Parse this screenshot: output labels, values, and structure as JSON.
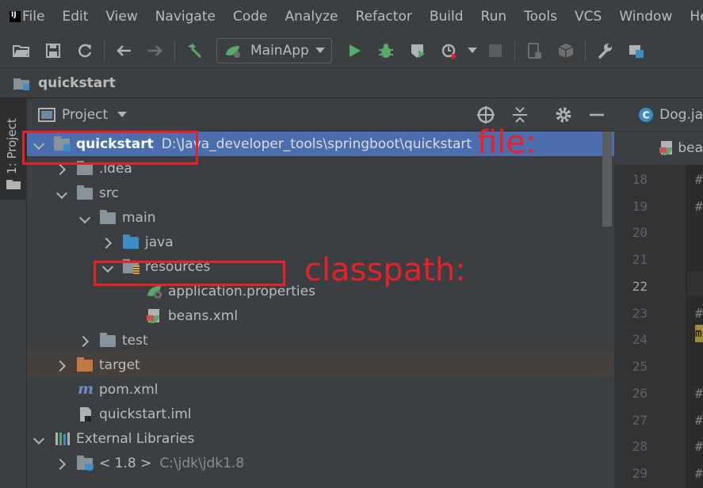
{
  "menu": [
    "File",
    "Edit",
    "View",
    "Navigate",
    "Code",
    "Analyze",
    "Refactor",
    "Build",
    "Run",
    "Tools",
    "VCS",
    "Window",
    "Help"
  ],
  "toolbar": {
    "run_config": "MainApp"
  },
  "navbar": {
    "project_name": "quickstart"
  },
  "left_strip": {
    "project_tab": "1: Project"
  },
  "panel": {
    "title": "Project"
  },
  "tree": [
    {
      "label": "quickstart",
      "path": "D:\\Java_developer_tools\\springboot\\quickstart",
      "icon": "module-folder-icon",
      "expanded": true
    },
    {
      "label": ".idea",
      "icon": "folder-icon",
      "expanded": false
    },
    {
      "label": "src",
      "icon": "folder-icon",
      "expanded": true
    },
    {
      "label": "main",
      "icon": "folder-icon",
      "expanded": true
    },
    {
      "label": "java",
      "icon": "source-folder-icon",
      "expanded": false
    },
    {
      "label": "resources",
      "icon": "resources-folder-icon",
      "expanded": true
    },
    {
      "label": "application.properties",
      "icon": "spring-properties-icon"
    },
    {
      "label": "beans.xml",
      "icon": "spring-xml-icon"
    },
    {
      "label": "test",
      "icon": "folder-icon",
      "expanded": false
    },
    {
      "label": "target",
      "icon": "excluded-folder-icon",
      "expanded": false
    },
    {
      "label": "pom.xml",
      "icon": "maven-icon"
    },
    {
      "label": "quickstart.iml",
      "icon": "iml-file-icon"
    },
    {
      "label": "External Libraries",
      "icon": "libraries-icon",
      "expanded": true
    },
    {
      "label": "< 1.8 >",
      "path": "C:\\jdk\\jdk1.8",
      "icon": "jdk-icon",
      "expanded": false
    }
  ],
  "annotations": {
    "file_label": "file:",
    "classpath_label": "classpath:"
  },
  "editor": {
    "tab_label": "Dog.ja",
    "breadcrumb": "bea",
    "line_numbers": [
      "18",
      "19",
      "20",
      "21",
      "22",
      "23",
      "24",
      "25",
      "26",
      "27",
      "28",
      "29"
    ],
    "current_line": "22",
    "code_marks": [
      "#",
      "#",
      "",
      "",
      "",
      "#",
      "m",
      "",
      "#",
      "#",
      "#",
      "#"
    ]
  },
  "colors": {
    "selection": "#4b6eaf",
    "annotation_red": "#e8202a",
    "run_green": "#59a869",
    "source_blue": "#3d8ec5",
    "excluded_orange": "#c27843"
  }
}
